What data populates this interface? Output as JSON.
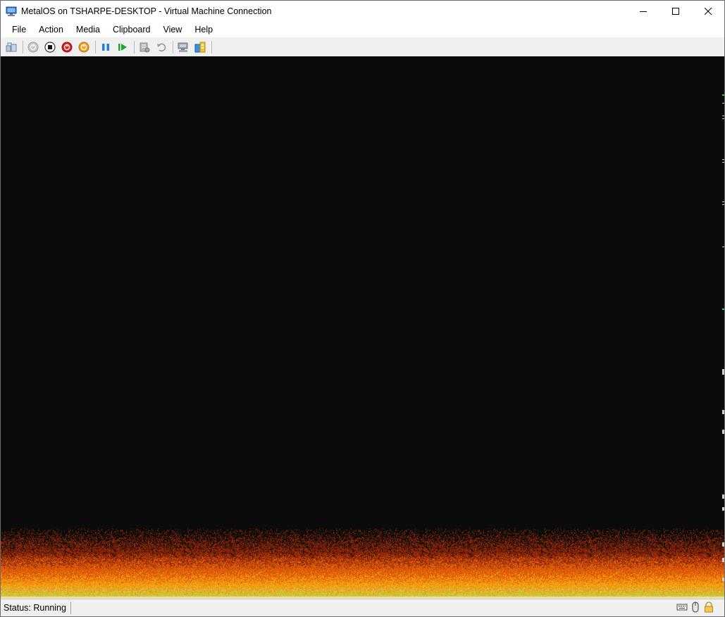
{
  "window": {
    "title": "MetalOS on TSHARPE-DESKTOP - Virtual Machine Connection"
  },
  "menu": [
    {
      "label": "File"
    },
    {
      "label": "Action"
    },
    {
      "label": "Media"
    },
    {
      "label": "Clipboard"
    },
    {
      "label": "View"
    },
    {
      "label": "Help"
    }
  ],
  "toolbar": {
    "buttons": [
      {
        "icon": "ctrl-alt-del-icon"
      },
      {
        "icon": "start-icon"
      },
      {
        "icon": "turn-off-icon"
      },
      {
        "icon": "shut-down-icon"
      },
      {
        "icon": "save-icon"
      },
      {
        "icon": "pause-icon"
      },
      {
        "icon": "resume-icon"
      },
      {
        "icon": "checkpoint-icon"
      },
      {
        "icon": "revert-icon"
      },
      {
        "icon": "enhanced-session-icon"
      },
      {
        "icon": "share-icon"
      }
    ]
  },
  "screen": {
    "background": "#0b0b0b",
    "fire_colors": [
      "#b8b32a",
      "#f58a12",
      "#c24a10",
      "#6e1c08"
    ]
  },
  "status": {
    "text": "Status: Running",
    "icons": [
      "keyboard-icon",
      "mouse-icon",
      "lock-icon"
    ]
  }
}
